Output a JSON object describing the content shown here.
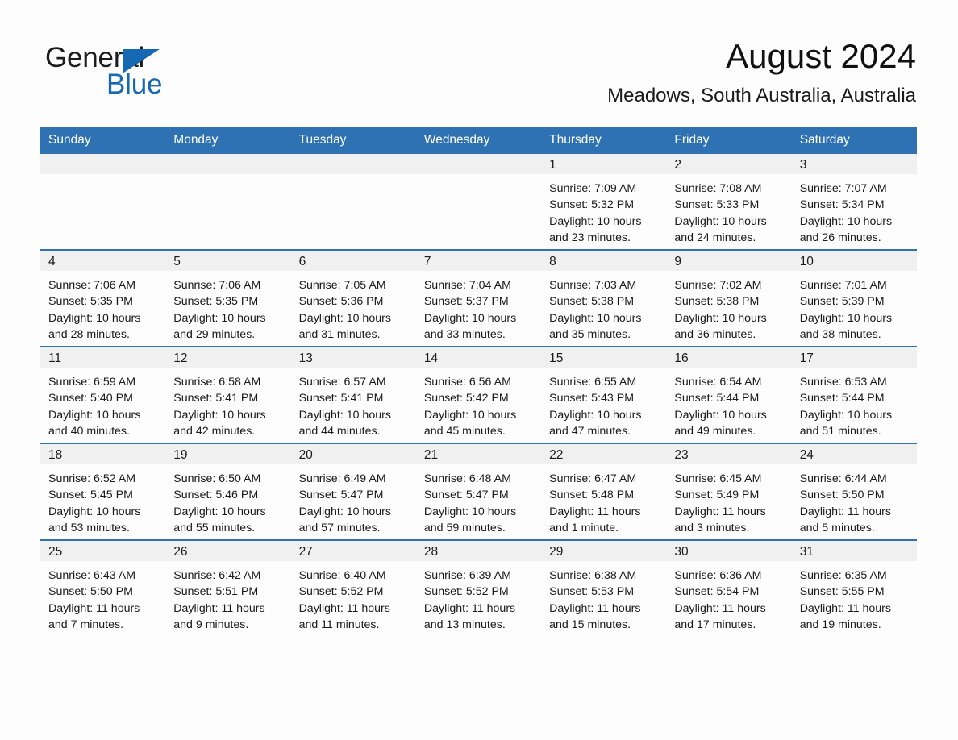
{
  "brand": {
    "name_part1": "General",
    "name_part2": "Blue",
    "logo_icon": "triangle-icon",
    "accent_color": "#1668b3"
  },
  "header": {
    "title": "August 2024",
    "subtitle": "Meadows, South Australia, Australia"
  },
  "theme": {
    "header_blue": "#2f72b4",
    "band_gray": "#f0f0f0",
    "text": "#1a1a1a"
  },
  "calendar": {
    "weekday_headers": [
      "Sunday",
      "Monday",
      "Tuesday",
      "Wednesday",
      "Thursday",
      "Friday",
      "Saturday"
    ],
    "weeks": [
      [
        {
          "day": "",
          "lines": []
        },
        {
          "day": "",
          "lines": []
        },
        {
          "day": "",
          "lines": []
        },
        {
          "day": "",
          "lines": []
        },
        {
          "day": "1",
          "lines": [
            "Sunrise: 7:09 AM",
            "Sunset: 5:32 PM",
            "Daylight: 10 hours",
            "and 23 minutes."
          ]
        },
        {
          "day": "2",
          "lines": [
            "Sunrise: 7:08 AM",
            "Sunset: 5:33 PM",
            "Daylight: 10 hours",
            "and 24 minutes."
          ]
        },
        {
          "day": "3",
          "lines": [
            "Sunrise: 7:07 AM",
            "Sunset: 5:34 PM",
            "Daylight: 10 hours",
            "and 26 minutes."
          ]
        }
      ],
      [
        {
          "day": "4",
          "lines": [
            "Sunrise: 7:06 AM",
            "Sunset: 5:35 PM",
            "Daylight: 10 hours",
            "and 28 minutes."
          ]
        },
        {
          "day": "5",
          "lines": [
            "Sunrise: 7:06 AM",
            "Sunset: 5:35 PM",
            "Daylight: 10 hours",
            "and 29 minutes."
          ]
        },
        {
          "day": "6",
          "lines": [
            "Sunrise: 7:05 AM",
            "Sunset: 5:36 PM",
            "Daylight: 10 hours",
            "and 31 minutes."
          ]
        },
        {
          "day": "7",
          "lines": [
            "Sunrise: 7:04 AM",
            "Sunset: 5:37 PM",
            "Daylight: 10 hours",
            "and 33 minutes."
          ]
        },
        {
          "day": "8",
          "lines": [
            "Sunrise: 7:03 AM",
            "Sunset: 5:38 PM",
            "Daylight: 10 hours",
            "and 35 minutes."
          ]
        },
        {
          "day": "9",
          "lines": [
            "Sunrise: 7:02 AM",
            "Sunset: 5:38 PM",
            "Daylight: 10 hours",
            "and 36 minutes."
          ]
        },
        {
          "day": "10",
          "lines": [
            "Sunrise: 7:01 AM",
            "Sunset: 5:39 PM",
            "Daylight: 10 hours",
            "and 38 minutes."
          ]
        }
      ],
      [
        {
          "day": "11",
          "lines": [
            "Sunrise: 6:59 AM",
            "Sunset: 5:40 PM",
            "Daylight: 10 hours",
            "and 40 minutes."
          ]
        },
        {
          "day": "12",
          "lines": [
            "Sunrise: 6:58 AM",
            "Sunset: 5:41 PM",
            "Daylight: 10 hours",
            "and 42 minutes."
          ]
        },
        {
          "day": "13",
          "lines": [
            "Sunrise: 6:57 AM",
            "Sunset: 5:41 PM",
            "Daylight: 10 hours",
            "and 44 minutes."
          ]
        },
        {
          "day": "14",
          "lines": [
            "Sunrise: 6:56 AM",
            "Sunset: 5:42 PM",
            "Daylight: 10 hours",
            "and 45 minutes."
          ]
        },
        {
          "day": "15",
          "lines": [
            "Sunrise: 6:55 AM",
            "Sunset: 5:43 PM",
            "Daylight: 10 hours",
            "and 47 minutes."
          ]
        },
        {
          "day": "16",
          "lines": [
            "Sunrise: 6:54 AM",
            "Sunset: 5:44 PM",
            "Daylight: 10 hours",
            "and 49 minutes."
          ]
        },
        {
          "day": "17",
          "lines": [
            "Sunrise: 6:53 AM",
            "Sunset: 5:44 PM",
            "Daylight: 10 hours",
            "and 51 minutes."
          ]
        }
      ],
      [
        {
          "day": "18",
          "lines": [
            "Sunrise: 6:52 AM",
            "Sunset: 5:45 PM",
            "Daylight: 10 hours",
            "and 53 minutes."
          ]
        },
        {
          "day": "19",
          "lines": [
            "Sunrise: 6:50 AM",
            "Sunset: 5:46 PM",
            "Daylight: 10 hours",
            "and 55 minutes."
          ]
        },
        {
          "day": "20",
          "lines": [
            "Sunrise: 6:49 AM",
            "Sunset: 5:47 PM",
            "Daylight: 10 hours",
            "and 57 minutes."
          ]
        },
        {
          "day": "21",
          "lines": [
            "Sunrise: 6:48 AM",
            "Sunset: 5:47 PM",
            "Daylight: 10 hours",
            "and 59 minutes."
          ]
        },
        {
          "day": "22",
          "lines": [
            "Sunrise: 6:47 AM",
            "Sunset: 5:48 PM",
            "Daylight: 11 hours",
            "and 1 minute."
          ]
        },
        {
          "day": "23",
          "lines": [
            "Sunrise: 6:45 AM",
            "Sunset: 5:49 PM",
            "Daylight: 11 hours",
            "and 3 minutes."
          ]
        },
        {
          "day": "24",
          "lines": [
            "Sunrise: 6:44 AM",
            "Sunset: 5:50 PM",
            "Daylight: 11 hours",
            "and 5 minutes."
          ]
        }
      ],
      [
        {
          "day": "25",
          "lines": [
            "Sunrise: 6:43 AM",
            "Sunset: 5:50 PM",
            "Daylight: 11 hours",
            "and 7 minutes."
          ]
        },
        {
          "day": "26",
          "lines": [
            "Sunrise: 6:42 AM",
            "Sunset: 5:51 PM",
            "Daylight: 11 hours",
            "and 9 minutes."
          ]
        },
        {
          "day": "27",
          "lines": [
            "Sunrise: 6:40 AM",
            "Sunset: 5:52 PM",
            "Daylight: 11 hours",
            "and 11 minutes."
          ]
        },
        {
          "day": "28",
          "lines": [
            "Sunrise: 6:39 AM",
            "Sunset: 5:52 PM",
            "Daylight: 11 hours",
            "and 13 minutes."
          ]
        },
        {
          "day": "29",
          "lines": [
            "Sunrise: 6:38 AM",
            "Sunset: 5:53 PM",
            "Daylight: 11 hours",
            "and 15 minutes."
          ]
        },
        {
          "day": "30",
          "lines": [
            "Sunrise: 6:36 AM",
            "Sunset: 5:54 PM",
            "Daylight: 11 hours",
            "and 17 minutes."
          ]
        },
        {
          "day": "31",
          "lines": [
            "Sunrise: 6:35 AM",
            "Sunset: 5:55 PM",
            "Daylight: 11 hours",
            "and 19 minutes."
          ]
        }
      ]
    ]
  }
}
